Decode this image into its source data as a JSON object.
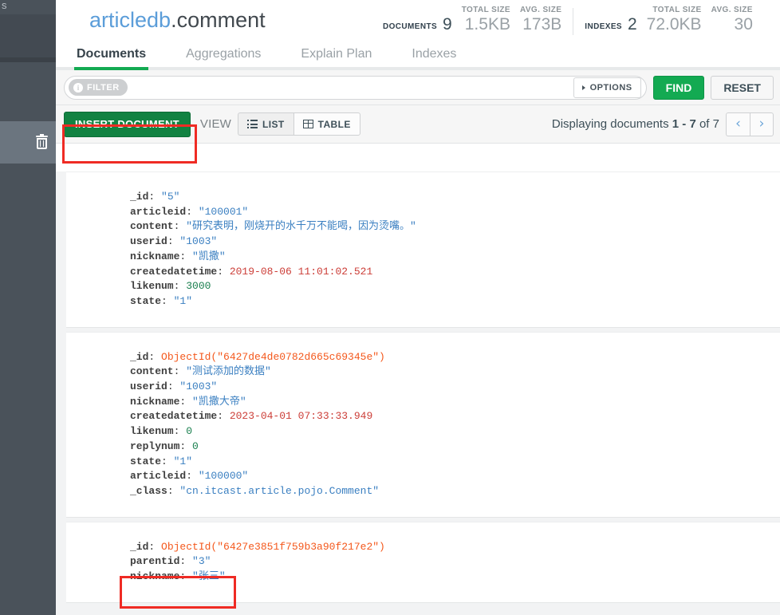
{
  "sidebar": {
    "top_partial_label": "s",
    "trash_icon_name": "delete-collection-icon"
  },
  "header": {
    "db_name": "articledb",
    "separator": ".",
    "collection_name": "comment",
    "stats": [
      {
        "label": "DOCUMENTS",
        "value": "9",
        "inline": true,
        "dark": true
      },
      {
        "label": "TOTAL SIZE",
        "value": "1.5KB",
        "inline": false,
        "dark": false
      },
      {
        "label": "AVG. SIZE",
        "value": "173B",
        "inline": false,
        "dark": false
      },
      {
        "label": "INDEXES",
        "value": "2",
        "inline": true,
        "dark": true
      },
      {
        "label": "TOTAL SIZE",
        "value": "72.0KB",
        "inline": false,
        "dark": false
      },
      {
        "label": "AVG. SIZE",
        "value": "30",
        "inline": false,
        "dark": false
      }
    ]
  },
  "tabs": [
    {
      "label": "Documents",
      "active": true
    },
    {
      "label": "Aggregations",
      "active": false
    },
    {
      "label": "Explain Plan",
      "active": false
    },
    {
      "label": "Indexes",
      "active": false
    }
  ],
  "toolbar": {
    "filter_badge": "FILTER",
    "filter_info_icon": "info-icon",
    "filter_value": "",
    "filter_placeholder": "",
    "options_label": "OPTIONS",
    "find_label": "FIND",
    "reset_label": "RESET",
    "insert_label": "INSERT DOCUMENT",
    "view_label": "VIEW",
    "list_label": "LIST",
    "table_label": "TABLE",
    "pagination_prefix": "Displaying documents",
    "pagination_range": "1 - 7",
    "pagination_of": "of",
    "pagination_total": "7",
    "prev_glyph": "‹",
    "next_glyph": "›"
  },
  "documents": [
    {
      "fields": [
        {
          "key": "_id",
          "value": "\"5\"",
          "type": "str"
        },
        {
          "key": "articleid",
          "value": "\"100001\"",
          "type": "str"
        },
        {
          "key": "content",
          "value": "\"研究表明，刚烧开的水千万不能喝，因为烫嘴。\"",
          "type": "str"
        },
        {
          "key": "userid",
          "value": "\"1003\"",
          "type": "str"
        },
        {
          "key": "nickname",
          "value": "\"凯撒\"",
          "type": "str"
        },
        {
          "key": "createdatetime",
          "value": "2019-08-06 11:01:02.521",
          "type": "date"
        },
        {
          "key": "likenum",
          "value": "3000",
          "type": "num"
        },
        {
          "key": "state",
          "value": "\"1\"",
          "type": "str"
        }
      ]
    },
    {
      "fields": [
        {
          "key": "_id",
          "value": "ObjectId(\"6427de4de0782d665c69345e\")",
          "type": "oid"
        },
        {
          "key": "content",
          "value": "\"测试添加的数据\"",
          "type": "str"
        },
        {
          "key": "userid",
          "value": "\"1003\"",
          "type": "str"
        },
        {
          "key": "nickname",
          "value": "\"凯撒大帝\"",
          "type": "str"
        },
        {
          "key": "createdatetime",
          "value": "2023-04-01 07:33:33.949",
          "type": "date"
        },
        {
          "key": "likenum",
          "value": "0",
          "type": "num"
        },
        {
          "key": "replynum",
          "value": "0",
          "type": "num"
        },
        {
          "key": "state",
          "value": "\"1\"",
          "type": "str"
        },
        {
          "key": "articleid",
          "value": "\"100000\"",
          "type": "str"
        },
        {
          "key": "_class",
          "value": "\"cn.itcast.article.pojo.Comment\"",
          "type": "str"
        }
      ]
    },
    {
      "fields": [
        {
          "key": "_id",
          "value": "ObjectId(\"6427e3851f759b3a90f217e2\")",
          "type": "oid"
        },
        {
          "key": "parentid",
          "value": "\"3\"",
          "type": "str"
        },
        {
          "key": "nickname",
          "value": "\"张三\"",
          "type": "str"
        }
      ]
    }
  ],
  "annotations": {
    "color": "#ef2b24",
    "items": [
      {
        "name": "insert-document-highlight"
      },
      {
        "name": "parentid-nickname-highlight"
      }
    ]
  }
}
